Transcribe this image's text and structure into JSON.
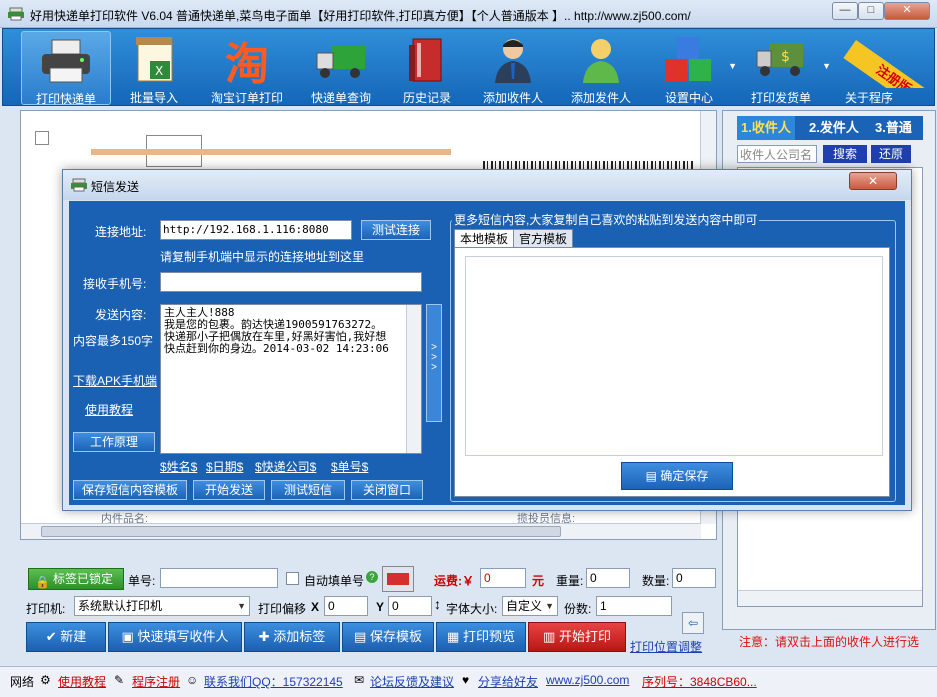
{
  "window": {
    "title": "好用快递单打印软件 V6.04 普通快递单,菜鸟电子面单【好用打印软件,打印真方便】【个人普通版本 】..  http://www.zj500.com/",
    "min": "—",
    "max": "□",
    "close": "✕"
  },
  "toolbar": {
    "items": [
      {
        "label": "打印快递单",
        "icon": "printer-icon"
      },
      {
        "label": "批量导入",
        "icon": "excel-import-icon"
      },
      {
        "label": "淘宝订单打印",
        "icon": "taobao-icon"
      },
      {
        "label": "快递单查询",
        "icon": "truck-icon"
      },
      {
        "label": "历史记录",
        "icon": "books-icon"
      },
      {
        "label": "添加收件人",
        "icon": "person-icon"
      },
      {
        "label": "添加发件人",
        "icon": "person-green-icon"
      },
      {
        "label": "设置中心",
        "icon": "cubes-icon"
      },
      {
        "label": "打印发货单",
        "icon": "money-truck-icon"
      },
      {
        "label": "关于程序",
        "icon": "about-icon"
      }
    ],
    "register_badge": "注册版本"
  },
  "right_panel": {
    "tabs": [
      "1.收件人",
      "2.发件人",
      "3.普通"
    ],
    "search_placeholder": "收件人公司名",
    "search_button": "搜索",
    "reset_button": "还原",
    "note": "注意：请双击上面的收件人进行选"
  },
  "preview": {
    "field_inner": "内件品名:",
    "field_info": "揽投员信息:"
  },
  "dialog": {
    "title": "短信发送",
    "close": "✕",
    "connect_label": "连接地址:",
    "connect_value": "http://192.168.1.116:8080",
    "test_connect": "测试连接",
    "connect_hint": "请复制手机端中显示的连接地址到这里",
    "phone_label": "接收手机号:",
    "phone_value": "",
    "content_label": "发送内容:",
    "content_limit": "内容最多150字",
    "content_text": "主人主人!888\n我是您的包裹。韵达快递1900591763272。\n快递那小子把偶放在车里,好黑好害怕,我好想\n快点赶到你的身边。2014-03-02 14:23:06",
    "download_apk": "下载APK手机端",
    "tutorial": "使用教程",
    "how_it_works": "工作原理",
    "vars": [
      "$姓名$",
      "$日期$",
      "$快递公司$",
      "$单号$"
    ],
    "buttons": [
      "保存短信内容模板",
      "开始发送",
      "测试短信",
      "关闭窗口"
    ],
    "group_title": "更多短信内容,大家复制自己喜欢的粘贴到发送内容中即可",
    "tabs": [
      "本地模板",
      "官方模板"
    ],
    "save_button": "确定保存",
    "arrows": "> > >"
  },
  "bottom": {
    "lock_label": "标签已锁定",
    "order_label": "单号:",
    "auto_fill": "自动填单号",
    "freight_label": "运费:￥",
    "freight_value": "0",
    "yuan": "元",
    "weight_label": "重量:",
    "weight_value": "0",
    "qty_label": "数量:",
    "qty_value": "0",
    "printer_label": "打印机:",
    "printer_value": "系统默认打印机",
    "offset_label": "打印偏移",
    "x_label": "X",
    "x_value": "0",
    "y_label": "Y",
    "y_value": "0",
    "font_label": "字体大小:",
    "font_value": "自定义",
    "copies_label": "份数:",
    "copies_value": "1",
    "actions": [
      "新建",
      "快速填写收件人",
      "添加标签",
      "保存模板",
      "打印预览",
      "开始打印"
    ],
    "position_link": "打印位置调整"
  },
  "status": {
    "network": "网络",
    "items": [
      "使用教程",
      "程序注册",
      "联系我们QQ：157322145",
      "论坛反馈及建议",
      "分享给好友",
      "www.zj500.com",
      "序列号：3848CB60..."
    ]
  }
}
